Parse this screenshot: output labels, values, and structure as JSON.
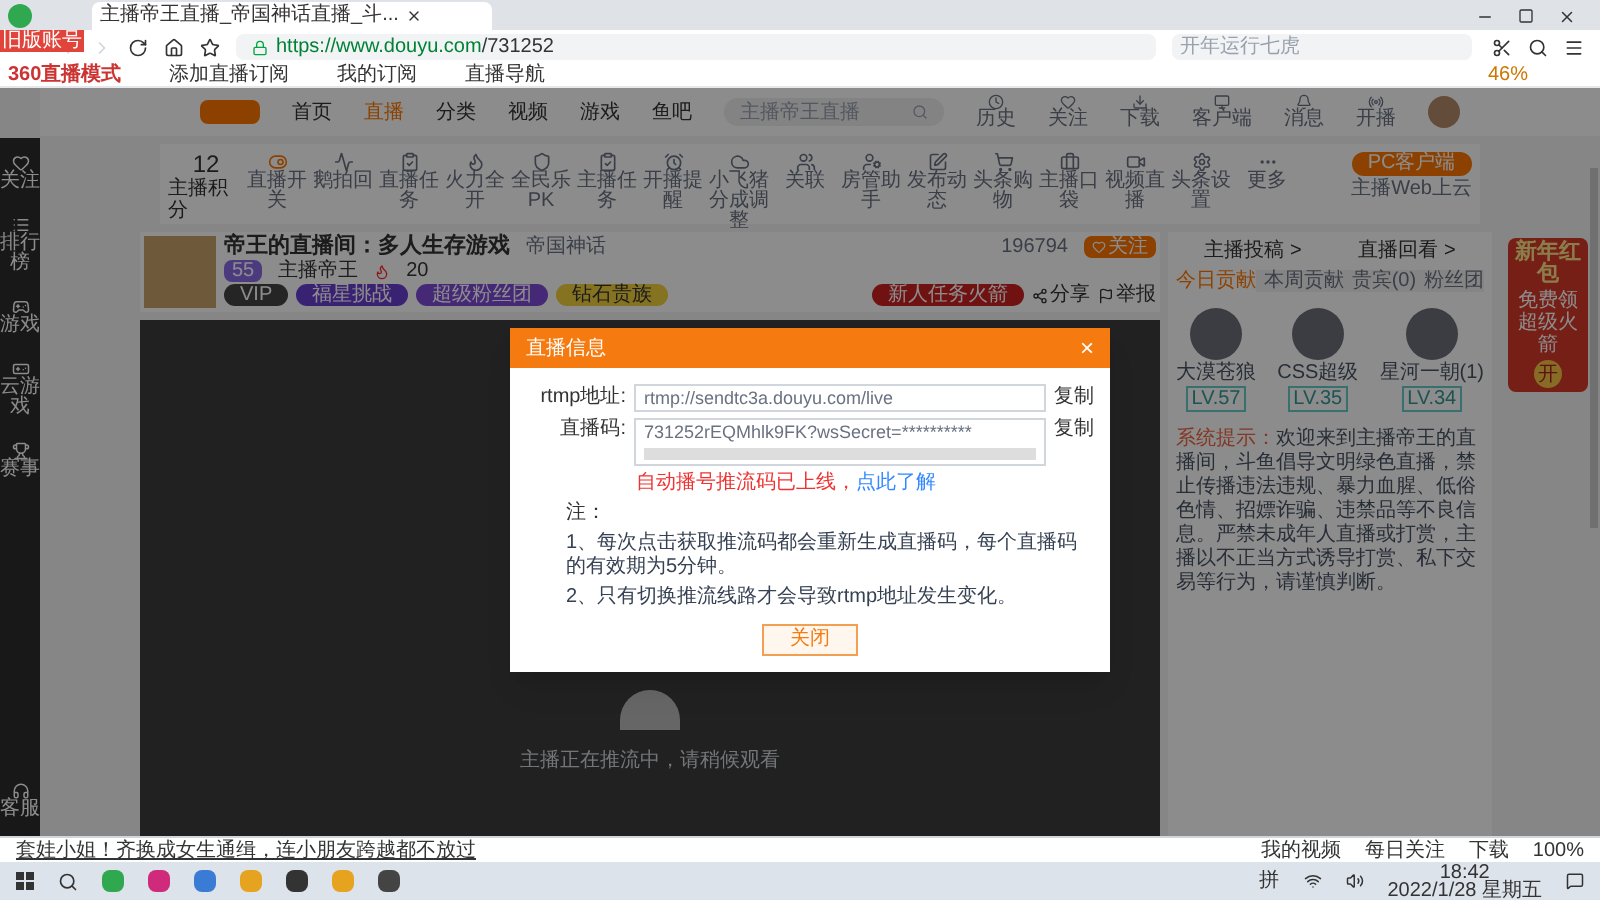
{
  "browser": {
    "tab_title": "主播帝王直播_帝国神话直播_斗...",
    "url_host": "https://www.douyu.com",
    "url_path": "/731252",
    "search_placeholder": "开年运行七虎",
    "badge": "旧版账号",
    "bookmarks": [
      "360直播模式",
      "添加直播订阅",
      "我的订阅",
      "直播导航"
    ],
    "battery": "46%"
  },
  "site_nav": {
    "items": [
      {
        "label": "首页",
        "selected": false
      },
      {
        "label": "直播",
        "selected": true
      },
      {
        "label": "分类",
        "selected": false
      },
      {
        "label": "视频",
        "selected": false
      },
      {
        "label": "游戏",
        "selected": false
      },
      {
        "label": "鱼吧",
        "selected": false
      }
    ],
    "search_placeholder": "主播帝王直播",
    "user_icons": [
      "历史",
      "关注",
      "下载",
      "客户端",
      "消息",
      "开播"
    ]
  },
  "sidebar": [
    "关注",
    "排行榜",
    "游戏",
    "云游戏",
    "赛事",
    "客服"
  ],
  "toolbar": {
    "score": "12",
    "score_label": "主播积分",
    "items": [
      "直播开关",
      "鹅拍回",
      "直播任务",
      "火力全开",
      "全民乐PK",
      "主播任务",
      "开播提醒",
      "小飞猪分成调整",
      "关联",
      "房管助手",
      "发布动态",
      "头条购物",
      "主播口袋",
      "视频直播",
      "头条设置",
      "更多"
    ],
    "client_button": "PC客户端",
    "client_note": "主播Web上云"
  },
  "room": {
    "title": "帝王的直播间：多人生存游戏",
    "category": "帝国神话",
    "level": "55",
    "streamer": "主播帝王",
    "heat": "20",
    "follow_count": "196794",
    "follow_button": "关注",
    "tags": [
      "VIP",
      "福星挑战",
      "超级粉丝团",
      "钻石贵族"
    ],
    "task_button": "新人任务火箭",
    "share": "分享",
    "report": "举报"
  },
  "video": {
    "status": "主播正在推流中，请稍候观看"
  },
  "right_panel": {
    "links": [
      "主播投稿 >",
      "直播回看 >"
    ],
    "tabs": [
      {
        "label": "今日贡献",
        "selected": true
      },
      {
        "label": "本周贡献",
        "selected": false
      },
      {
        "label": "贵宾(0)",
        "selected": false
      },
      {
        "label": "粉丝团",
        "selected": false
      }
    ],
    "fans": [
      {
        "name": "大漠苍狼",
        "level": "LV.57"
      },
      {
        "name": "CSS超级",
        "level": "LV.35"
      },
      {
        "name": "星河一朝(1)",
        "level": "LV.34"
      }
    ],
    "notice_label": "系统提示：",
    "notice": "欢迎来到主播帝王的直播间，斗鱼倡导文明绿色直播，禁止传播违法违规、暴力血腥、低俗色情、招嫖诈骗、违禁品等不良信息。严禁未成年人直播或打赏，主播以不正当方式诱导打赏、私下交易等行为，请谨慎判断。"
  },
  "promo": {
    "title": "新年红包",
    "subtitle": "免费领超级火箭",
    "button": "开"
  },
  "dialog": {
    "title": "直播信息",
    "close": "×",
    "rtmp_label": "rtmp地址:",
    "rtmp_value": "rtmp://sendtc3a.douyu.com/live",
    "copy1": "复制",
    "code_label": "直播码:",
    "code_value": "731252rEQMhlk9FK?wsSecret=**********",
    "copy2": "复制",
    "warning": "自动播号推流码已上线，",
    "learn_more": "点此了解",
    "note_title": "注：",
    "notes": [
      "1、每次点击获取推流码都会重新生成直播码，每个直播码的有效期为5分钟。",
      "2、只有切换推流线路才会导致rtmp地址发生变化。"
    ],
    "button": "关闭"
  },
  "status_bar": {
    "news": "套娃小姐！齐换成女生通缉，连小朋友跨越都不放过",
    "items": [
      "我的视频",
      "每日关注",
      "下载"
    ],
    "zoom": "100%"
  },
  "taskbar": {
    "ime": "拼",
    "time": "18:42",
    "date": "2022/1/28 星期五"
  }
}
